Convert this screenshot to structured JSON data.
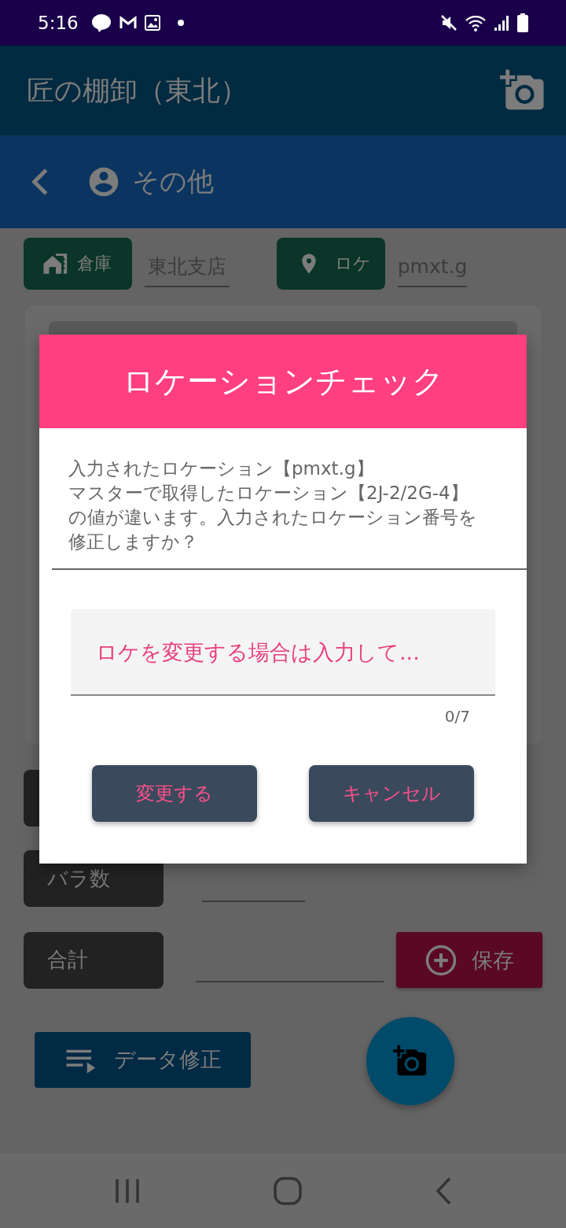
{
  "status_bar": {
    "time": "5:16"
  },
  "app_bar": {
    "title": "匠の棚卸（東北）"
  },
  "sub_bar": {
    "title": "その他"
  },
  "location_row": {
    "warehouse_label": "倉庫",
    "warehouse_value": "東北支店",
    "location_label": "ロケ",
    "location_value": "pmxt.g"
  },
  "form": {
    "rows": [
      {
        "label": "バラ数"
      },
      {
        "label": "合計"
      }
    ],
    "save_button": "保存",
    "edit_button": "データ修正"
  },
  "dialog": {
    "title": "ロケーションチェック",
    "message_lines": [
      "入力されたロケーション【pmxt.g】",
      "マスターで取得したロケーション【2J-2/2G-4】",
      "の値が違います。入力されたロケーション番号を",
      "修正しますか？"
    ],
    "input": {
      "placeholder": "ロケを変更する場合は入力して...",
      "counter": "0/7"
    },
    "buttons": [
      "変更する",
      "キャンセル"
    ]
  }
}
